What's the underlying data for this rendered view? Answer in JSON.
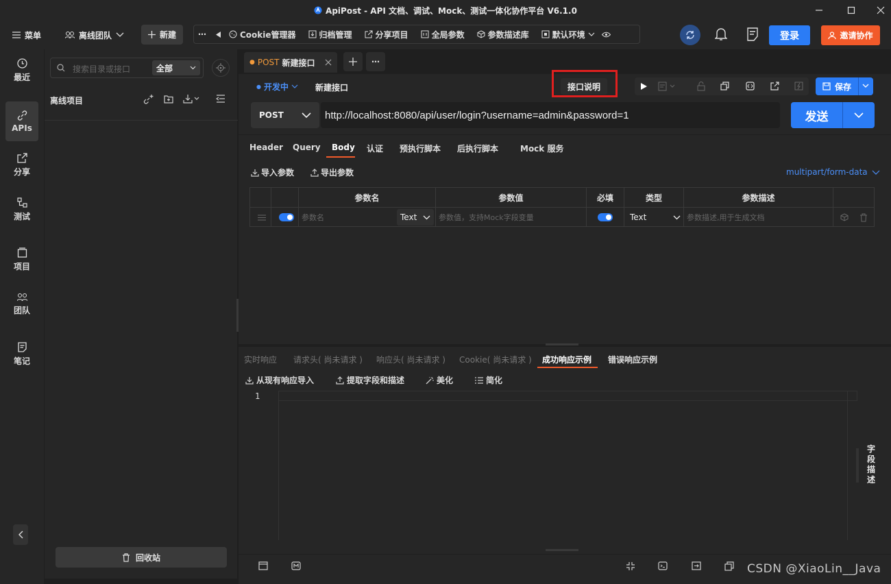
{
  "window": {
    "title": "ApiPost - API 文档、调试、Mock、测试一体化协作平台 V6.1.0"
  },
  "toolbar": {
    "menu_label": "菜单",
    "team_label": "离线团队",
    "new_label": "新建",
    "items": [
      "Cookie管理器",
      "归档管理",
      "分享项目",
      "全局参数",
      "参数描述库",
      "默认环境"
    ],
    "login_label": "登录",
    "invite_label": "邀请协作"
  },
  "nav": {
    "items": [
      "最近",
      "APIs",
      "分享",
      "测试",
      "项目",
      "团队",
      "笔记"
    ]
  },
  "tree": {
    "search_placeholder": "搜索目录或接口",
    "filter_label": "全部",
    "project_label": "离线项目",
    "recycle_label": "回收站"
  },
  "tab": {
    "method": "POST",
    "name": "新建接口"
  },
  "request": {
    "status_label": "开发中",
    "name_value": "新建接口",
    "doc_label": "接口说明",
    "save_label": "保存",
    "method": "POST",
    "url": "http://localhost:8080/api/user/login?username=admin&password=1",
    "send_label": "发送"
  },
  "subtabs": [
    "Header",
    "Query",
    "Body",
    "认证",
    "预执行脚本",
    "后执行脚本",
    "Mock 服务"
  ],
  "body": {
    "import_label": "导入参数",
    "export_label": "导出参数",
    "content_type": "multipart/form-data",
    "columns": [
      "参数名",
      "参数值",
      "必填",
      "类型",
      "参数描述"
    ],
    "row": {
      "name_placeholder": "参数名",
      "name_type": "Text",
      "value_placeholder": "参数值，支持Mock字段变量",
      "type": "Text",
      "desc_placeholder": "参数描述,用于生成文档"
    }
  },
  "response": {
    "tabs": [
      "实时响应",
      "请求头( 尚未请求 )",
      "响应头( 尚未请求 )",
      "Cookie( 尚未请求 )",
      "成功响应示例",
      "错误响应示例"
    ],
    "actions": [
      "从现有响应导入",
      "提取字段和描述",
      "美化",
      "简化"
    ],
    "line_number": "1",
    "side_label": "字段描述"
  },
  "watermark": "CSDN @XiaoLin__Java",
  "colors": {
    "accent": "#2b7cf6",
    "invite": "#f25a2a",
    "method": "#f29a3b",
    "highlight_box": "#e0201f"
  }
}
